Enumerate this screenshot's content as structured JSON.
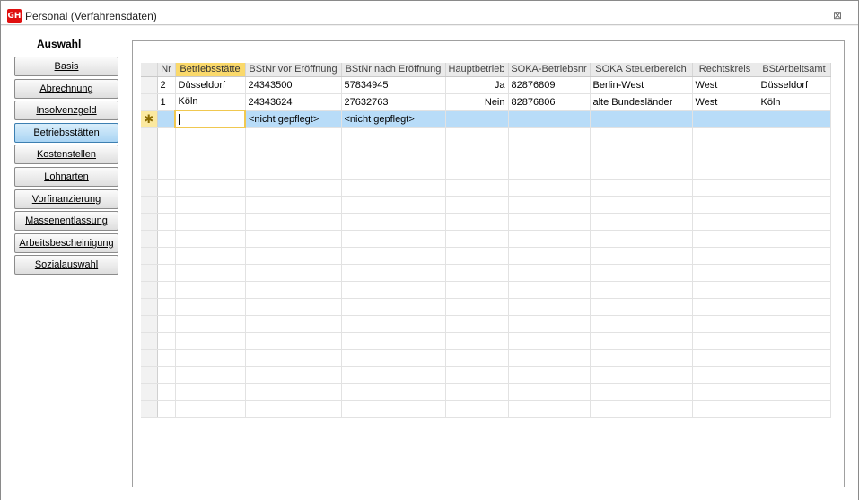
{
  "window": {
    "title": "Personal (Verfahrensdaten)",
    "app_icon_text": "GH",
    "close_glyph": "⊠",
    "accent": "#e01010"
  },
  "sidebar": {
    "heading": "Auswahl",
    "items": [
      {
        "label": "Basis",
        "active": false
      },
      {
        "label": "Abrechnung",
        "active": false
      },
      {
        "label": "Insolvenzgeld",
        "active": false
      },
      {
        "label": "Betriebsstätten",
        "active": true
      },
      {
        "label": "Kostenstellen",
        "active": false
      },
      {
        "label": "Lohnarten",
        "active": false
      },
      {
        "label": "Vorfinanzierung",
        "active": false
      },
      {
        "label": "Massenentlassung",
        "active": false
      },
      {
        "label": "Arbeitsbescheinigung",
        "active": false
      },
      {
        "label": "Sozialauswahl",
        "active": false
      }
    ]
  },
  "grid": {
    "columns": [
      "Nr",
      "Betriebsstätte",
      "BStNr vor Eröffnung",
      "BStNr nach Eröffnung",
      "Hauptbetrieb",
      "SOKA-Betriebsnr",
      "SOKA Steuerbereich",
      "Rechtskreis",
      "BStArbeitsamt"
    ],
    "selected_column": "Betriebsstätte",
    "rows": [
      {
        "nr": "2",
        "betriebsstaette": "Düsseldorf",
        "vor": "24343500",
        "nach": "57834945",
        "haupt": "Ja",
        "soka_nr": "82876809",
        "soka_steuer": "Berlin-West",
        "rechtskreis": "West",
        "arbeitsamt": "Düsseldorf"
      },
      {
        "nr": "1",
        "betriebsstaette": "Köln",
        "vor": "24343624",
        "nach": "27632763",
        "haupt": "Nein",
        "soka_nr": "82876806",
        "soka_steuer": "alte Bundesländer",
        "rechtskreis": "West",
        "arbeitsamt": "Köln"
      }
    ],
    "new_row": {
      "indicator": "✱",
      "vor": "<nicht gepflegt>",
      "nach": "<nicht gepflegt>"
    }
  }
}
